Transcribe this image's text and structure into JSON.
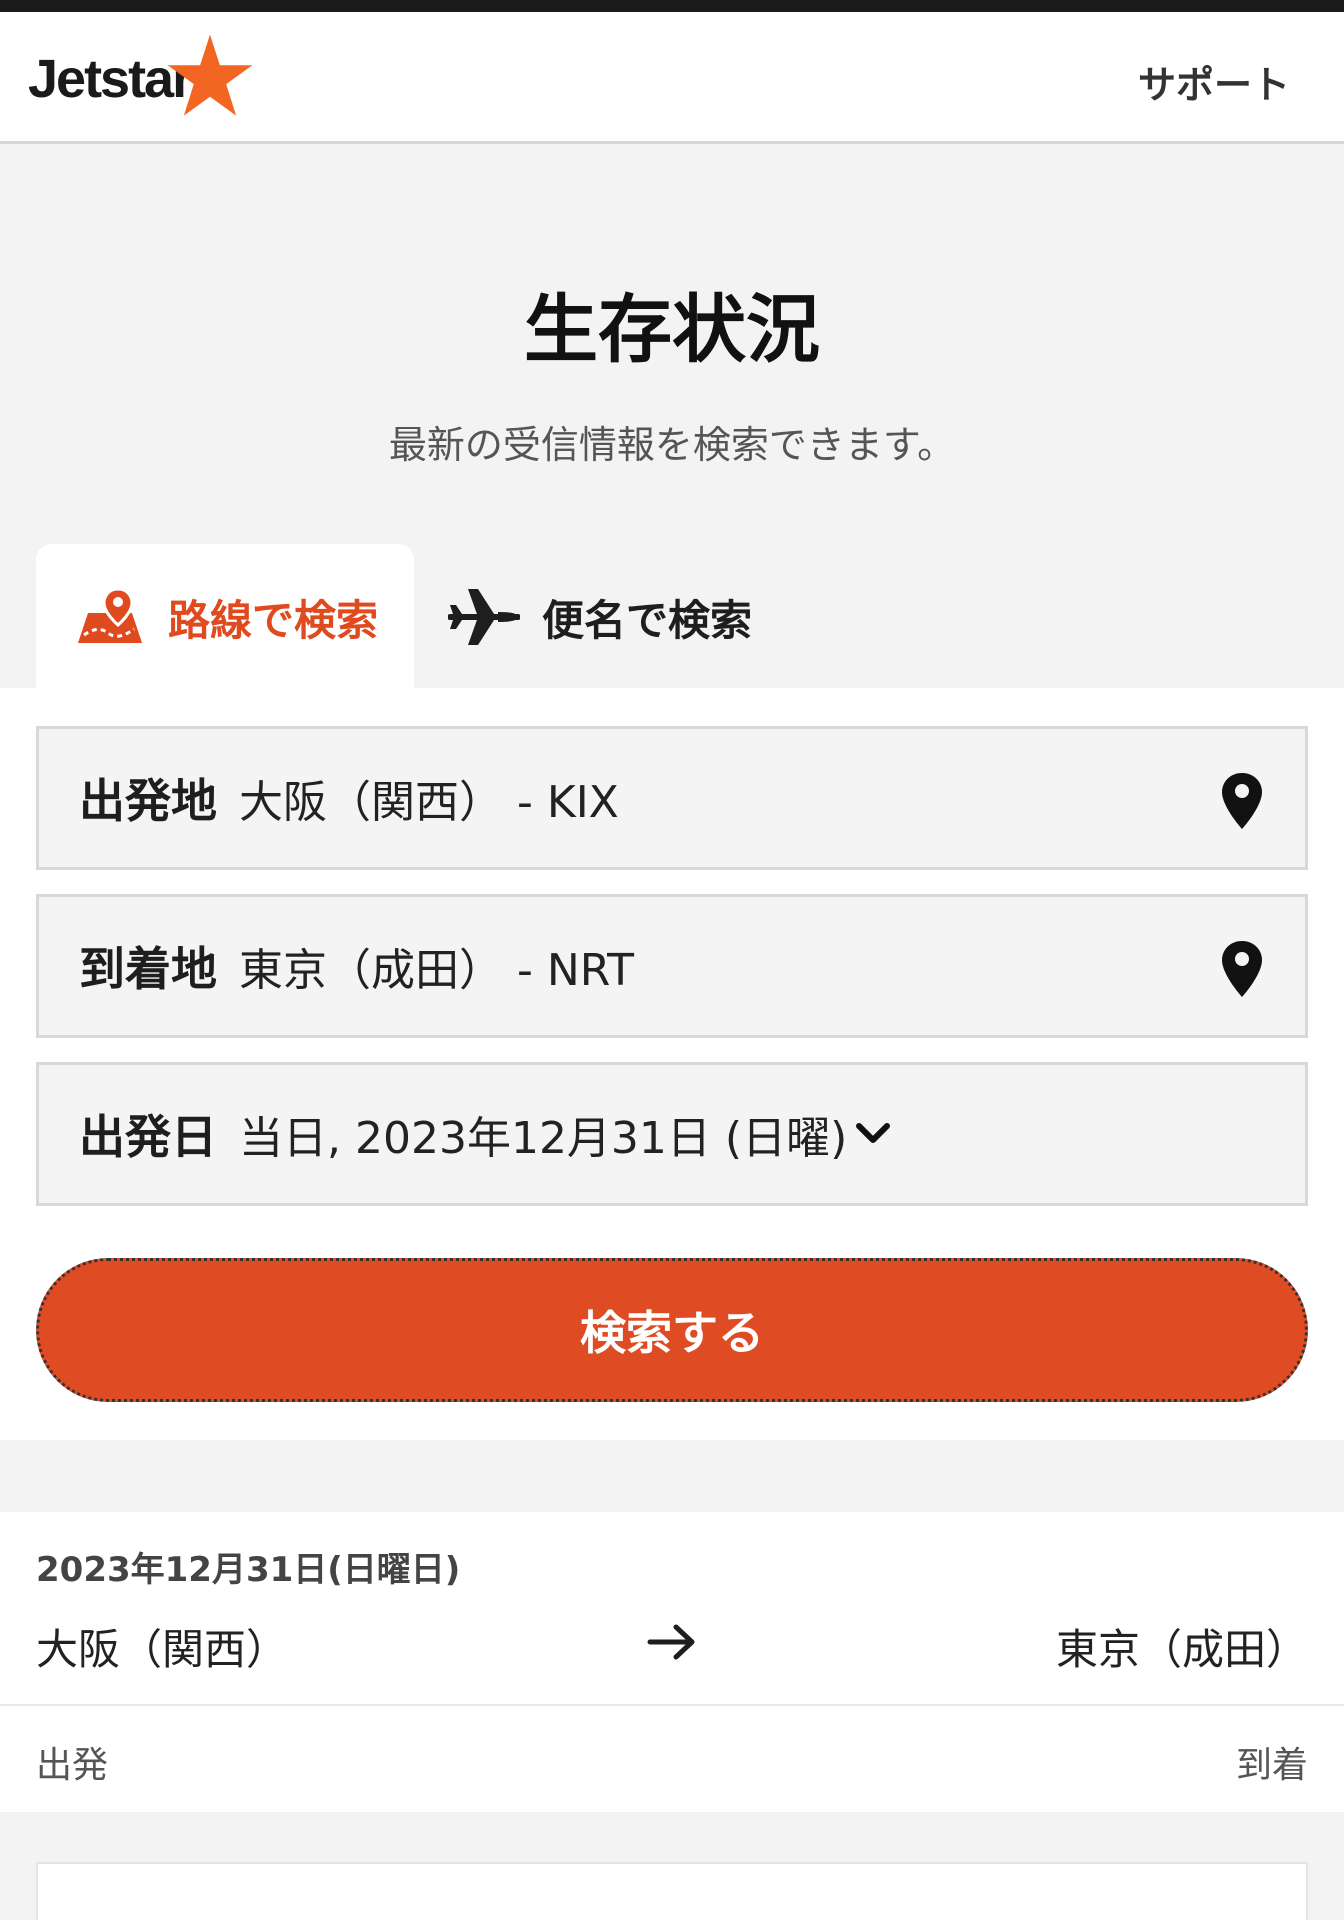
{
  "header": {
    "logo_text": "Jetstar",
    "support_label": "サポート"
  },
  "page": {
    "title": "生存状況",
    "subtitle": "最新の受信情報を検索できます。"
  },
  "tabs": [
    {
      "label": "路線で検索",
      "icon": "map-pin-icon",
      "active": true
    },
    {
      "label": "便名で検索",
      "icon": "airplane-icon",
      "active": false
    }
  ],
  "form": {
    "origin": {
      "label": "出発地",
      "value": "大阪（関西） - KIX",
      "icon": "location-pin-icon"
    },
    "destination": {
      "label": "到着地",
      "value": "東京（成田） - NRT",
      "icon": "location-pin-icon"
    },
    "date": {
      "label": "出発日",
      "value": "当日, 2023年12月31日 (日曜)",
      "icon": "chevron-down-icon"
    },
    "search_label": "検索する"
  },
  "result": {
    "date": "2023年12月31日(日曜日)",
    "from": "大阪（関西）",
    "to": "東京（成田）",
    "depart_label": "出発",
    "arrive_label": "到着"
  },
  "colors": {
    "accent": "#df4b23",
    "brand_star": "#f26522",
    "text_dark": "#1e1e1e"
  }
}
